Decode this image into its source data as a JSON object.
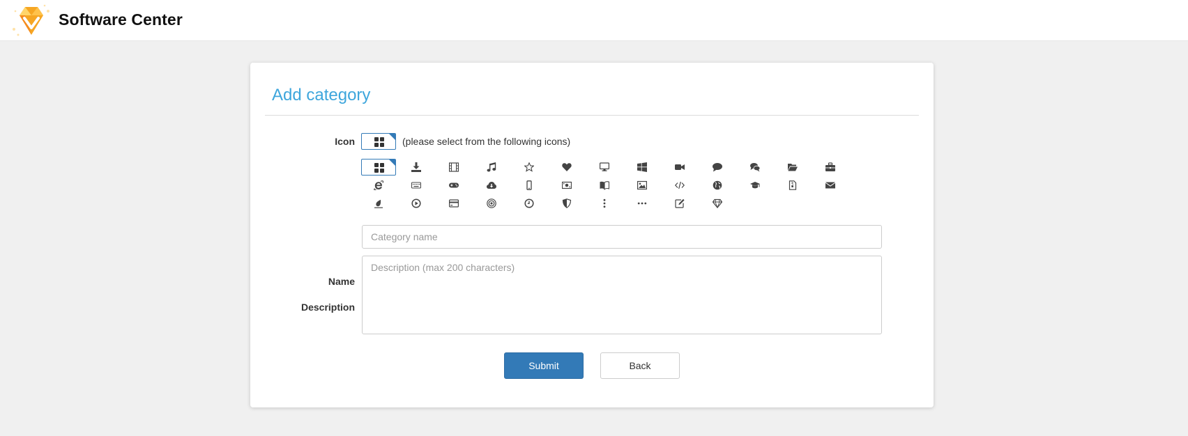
{
  "header": {
    "app_title": "Software Center",
    "logo_icon": "diamond-v-logo",
    "logo_colors": {
      "gold": "#f6a623",
      "orange": "#f58c1e",
      "light": "#ffd56a"
    }
  },
  "form": {
    "title": "Add category",
    "icon_label": "Icon",
    "icon_hint": "(please select from the following icons)",
    "selected_icon": "th-large-icon",
    "icons": [
      "th-large-icon",
      "download-icon",
      "film-icon",
      "music-icon",
      "star-outline-icon",
      "heart-icon",
      "desktop-icon",
      "windows-icon",
      "video-camera-icon",
      "comment-icon",
      "comments-icon",
      "folder-open-icon",
      "briefcase-icon",
      "internet-explorer-icon",
      "keyboard-icon",
      "gamepad-icon",
      "cloud-download-icon",
      "mobile-icon",
      "money-icon",
      "book-open-icon",
      "image-icon",
      "code-icon",
      "globe-icon",
      "graduation-cap-icon",
      "file-archive-icon",
      "envelope-icon",
      "eyedropper-icon",
      "play-circle-icon",
      "credit-card-icon",
      "bullseye-icon",
      "clock-icon",
      "shield-icon",
      "ellipsis-vertical-icon",
      "ellipsis-horizontal-icon",
      "edit-icon",
      "diamond-icon"
    ],
    "name_label": "Name",
    "name_value": "",
    "name_placeholder": "Category name",
    "description_label": "Description",
    "description_value": "",
    "description_placeholder": "Description (max 200 characters)",
    "submit_label": "Submit",
    "back_label": "Back"
  },
  "colors": {
    "accent": "#337ab7",
    "title": "#3ea6dc",
    "background": "#f0f0f0",
    "icon": "#444444"
  }
}
